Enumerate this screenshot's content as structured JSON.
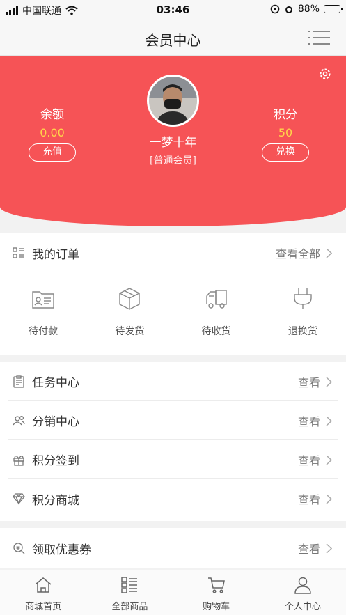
{
  "status_bar": {
    "carrier": "中国联通",
    "time": "03:46",
    "battery": "88%",
    "battery_level": 0.88
  },
  "nav": {
    "title": "会员中心",
    "menu_icon": "list-menu-icon"
  },
  "profile": {
    "balance_label": "余额",
    "balance_value": "0.00",
    "recharge_label": "充值",
    "points_label": "积分",
    "points_value": "50",
    "exchange_label": "兑换",
    "user_name": "一梦十年",
    "member_level": "[普通会员]",
    "settings_icon": "gear-icon"
  },
  "orders": {
    "title": "我的订单",
    "view_all": "查看全部",
    "items": [
      {
        "label": "待付款",
        "icon": "wallet-card-icon"
      },
      {
        "label": "待发货",
        "icon": "package-box-icon"
      },
      {
        "label": "待收货",
        "icon": "delivery-truck-icon"
      },
      {
        "label": "退换货",
        "icon": "plug-icon"
      }
    ]
  },
  "menu": [
    {
      "label": "任务中心",
      "action": "查看",
      "icon": "clipboard-icon"
    },
    {
      "label": "分销中心",
      "action": "查看",
      "icon": "users-icon"
    },
    {
      "label": "积分签到",
      "action": "查看",
      "icon": "gift-icon"
    },
    {
      "label": "积分商城",
      "action": "查看",
      "icon": "diamond-icon"
    },
    {
      "label": "领取优惠券",
      "action": "查看",
      "icon": "coupon-search-icon"
    }
  ],
  "tabbar": [
    {
      "label": "商城首页",
      "icon": "home-icon"
    },
    {
      "label": "全部商品",
      "icon": "category-grid-icon"
    },
    {
      "label": "购物车",
      "icon": "cart-icon"
    },
    {
      "label": "个人中心",
      "icon": "user-icon"
    }
  ],
  "colors": {
    "accent": "#f65356",
    "gold": "#ffd54a"
  }
}
